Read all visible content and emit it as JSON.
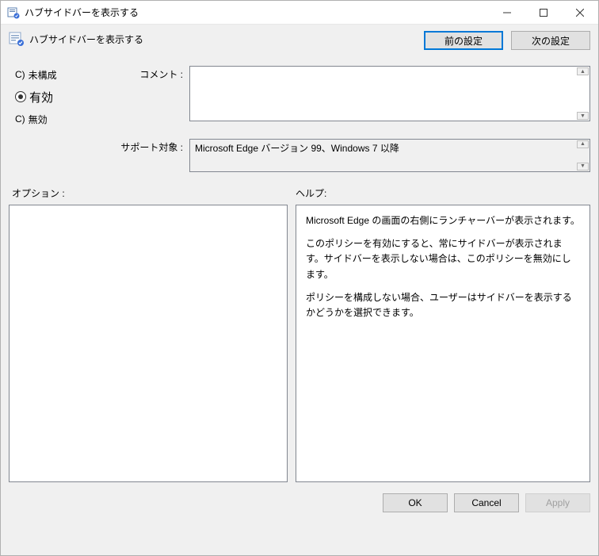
{
  "window": {
    "title": "ハブサイドバーを表示する"
  },
  "header": {
    "policy_title": "ハブサイドバーを表示する",
    "prev_btn": "前の設定",
    "next_btn": "次の設定"
  },
  "radios": {
    "not_configured": {
      "letter": "C)",
      "label": "未構成"
    },
    "enabled": {
      "letter": "◉",
      "label": "有効"
    },
    "disabled": {
      "letter": "C)",
      "label": "無効"
    }
  },
  "comment": {
    "label": "コメント :",
    "value": ""
  },
  "support": {
    "label": "サポート対象 :",
    "value": "Microsoft Edge バージョン 99、Windows 7 以降"
  },
  "sections": {
    "options_label": "オプション :",
    "help_label": "ヘルプ:"
  },
  "help": {
    "p1": "Microsoft Edge の画面の右側にランチャーバーが表示されます。",
    "p2": "このポリシーを有効にすると、常にサイドバーが表示されます。サイドバーを表示しない場合は、このポリシーを無効にします。",
    "p3": "ポリシーを構成しない場合、ユーザーはサイドバーを表示するかどうかを選択できます。"
  },
  "buttons": {
    "ok": "OK",
    "cancel": "Cancel",
    "apply": "Apply"
  }
}
